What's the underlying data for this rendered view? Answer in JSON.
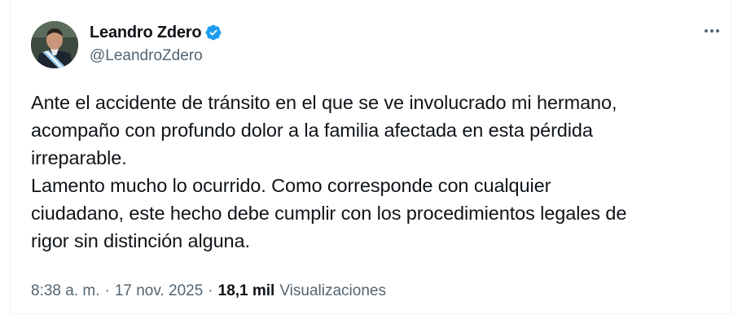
{
  "author": {
    "display_name": "Leandro Zdero",
    "handle": "@LeandroZdero",
    "verified": true,
    "verified_color": "#1d9bf0"
  },
  "tweet": {
    "lines": [
      "Ante el accidente de tránsito en el que se ve involucrado mi hermano,",
      "acompaño con profundo dolor a la familia afectada en esta pérdida",
      "irreparable.",
      "Lamento mucho lo ocurrido. Como corresponde con cualquier",
      "ciudadano, este hecho debe cumplir con los procedimientos legales de",
      "rigor sin distinción alguna."
    ]
  },
  "meta": {
    "time": "8:38 a. m.",
    "separator": "·",
    "date": "17 nov. 2025",
    "views_count": "18,1 mil",
    "views_label": "Visualizaciones"
  },
  "icons": {
    "more": "more-options-icon",
    "verified": "verified-badge-icon"
  }
}
